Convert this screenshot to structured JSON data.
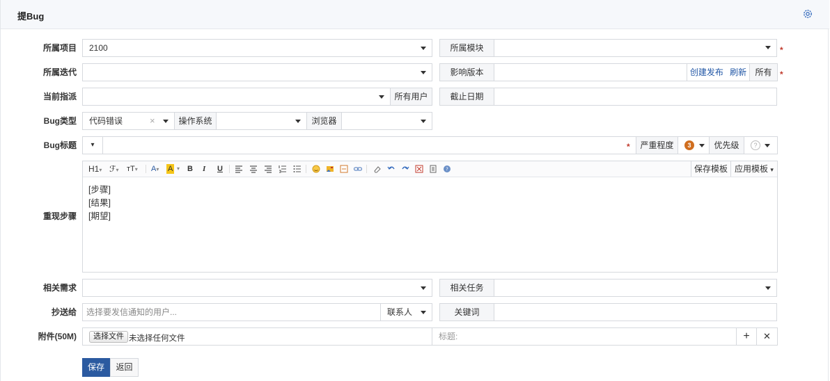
{
  "header": {
    "title": "提Bug",
    "settings_icon": "gear-icon"
  },
  "fields": {
    "product": {
      "label": "所属项目",
      "value": "2100"
    },
    "module": {
      "label": "所属模块",
      "value": ""
    },
    "iteration": {
      "label": "所属迭代",
      "value": ""
    },
    "affected_build": {
      "label": "影响版本",
      "value": "",
      "create_release_link": "创建发布",
      "refresh_link": "刷新",
      "all_button": "所有"
    },
    "assignee": {
      "label": "当前指派",
      "value": "",
      "all_users_button": "所有用户"
    },
    "deadline": {
      "label": "截止日期",
      "value": ""
    },
    "bug_type": {
      "label": "Bug类型",
      "value": "代码错误",
      "clear_glyph": "×"
    },
    "os": {
      "label": "操作系统",
      "value": ""
    },
    "browser": {
      "label": "浏览器",
      "value": ""
    },
    "title": {
      "label": "Bug标题",
      "value": "",
      "color_caret": "▾"
    },
    "severity": {
      "label": "严重程度",
      "value": "3"
    },
    "priority": {
      "label": "优先级",
      "value": "?"
    },
    "steps": {
      "label": "重现步骤",
      "lines": [
        "[步骤]",
        "[结果]",
        "[期望]"
      ]
    },
    "related_story": {
      "label": "相关需求",
      "value": ""
    },
    "related_task": {
      "label": "相关任务",
      "value": ""
    },
    "mailto": {
      "label": "抄送给",
      "placeholder": "选择要发信通知的用户...",
      "contacts_button": "联系人"
    },
    "keywords": {
      "label": "关键词",
      "value": ""
    },
    "attachment": {
      "label": "附件(50M)",
      "choose_button": "选择文件",
      "no_file_text": "未选择任何文件",
      "title_placeholder": "标题:",
      "add_glyph": "+",
      "remove_glyph": "✕"
    }
  },
  "editor_toolbar": {
    "heading": "H1",
    "font_family": "ℱ",
    "font_size": "тT",
    "font_color": "A",
    "bg_color": "A",
    "bold": "B",
    "italic": "I",
    "underline": "U",
    "save_template": "保存模板",
    "apply_template": "应用模板"
  },
  "actions": {
    "save": "保存",
    "back": "返回"
  },
  "colors": {
    "primary": "#2b5aa0",
    "required": "#c0392b",
    "link": "#2257a6",
    "severity_badge": "#d06e1f"
  }
}
